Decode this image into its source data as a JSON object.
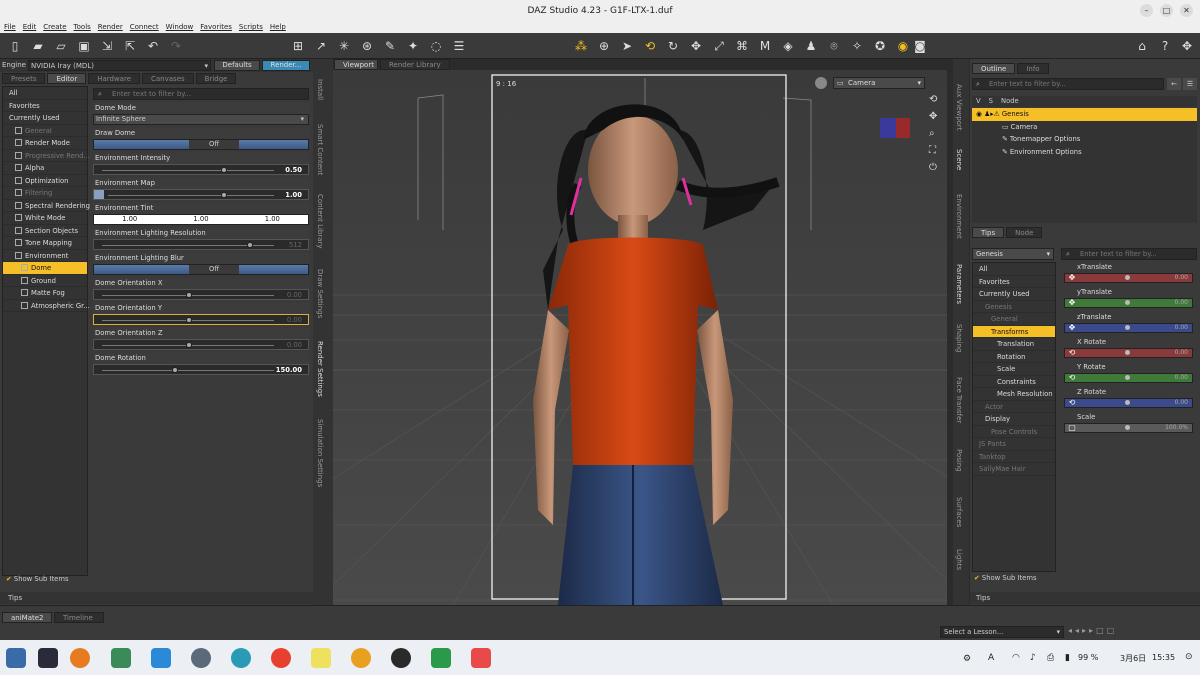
{
  "window": {
    "title": "DAZ Studio 4.23 - G1F-LTX-1.duf"
  },
  "menu": [
    "File",
    "Edit",
    "Create",
    "Tools",
    "Render",
    "Connect",
    "Window",
    "Favorites",
    "Scripts",
    "Help"
  ],
  "left_panel": {
    "engine_label": "Engine :",
    "engine_value": "NVIDIA Iray (MDL)",
    "defaults_btn": "Defaults",
    "render_btn": "Render...",
    "tabs": [
      "Presets",
      "Editor",
      "Hardware",
      "Canvases",
      "Bridge"
    ],
    "active_tab": "Editor",
    "filter_placeholder": "Enter text to filter by...",
    "categories": [
      {
        "label": "All",
        "state": "normal",
        "indent": 0
      },
      {
        "label": "Favorites",
        "state": "normal",
        "indent": 0
      },
      {
        "label": "Currently Used",
        "state": "normal",
        "indent": 0
      },
      {
        "label": "General",
        "state": "dim",
        "indent": 1
      },
      {
        "label": "Render Mode",
        "state": "normal",
        "indent": 1
      },
      {
        "label": "Progressive Rend...",
        "state": "dim",
        "indent": 1
      },
      {
        "label": "Alpha",
        "state": "normal",
        "indent": 1
      },
      {
        "label": "Optimization",
        "state": "normal",
        "indent": 1
      },
      {
        "label": "Filtering",
        "state": "dim",
        "indent": 1
      },
      {
        "label": "Spectral Rendering",
        "state": "normal",
        "indent": 1
      },
      {
        "label": "White Mode",
        "state": "normal",
        "indent": 1
      },
      {
        "label": "Section Objects",
        "state": "normal",
        "indent": 1
      },
      {
        "label": "Tone Mapping",
        "state": "normal",
        "indent": 1
      },
      {
        "label": "Environment",
        "state": "normal",
        "indent": 1
      },
      {
        "label": "Dome",
        "state": "selected",
        "indent": 2
      },
      {
        "label": "Ground",
        "state": "normal",
        "indent": 2
      },
      {
        "label": "Matte Fog",
        "state": "normal",
        "indent": 2
      },
      {
        "label": "Atmospheric Gr...",
        "state": "normal",
        "indent": 2
      }
    ],
    "show_sub_items": "Show Sub Items",
    "properties": {
      "dome_mode": {
        "label": "Dome Mode",
        "value": "Infinite Sphere"
      },
      "draw_dome": {
        "label": "Draw Dome",
        "value": "Off"
      },
      "env_intensity": {
        "label": "Environment Intensity",
        "value": "0.50",
        "level": 0.7
      },
      "env_map": {
        "label": "Environment Map",
        "value": "1.00",
        "level": 0.7
      },
      "env_tint": {
        "label": "Environment Tint",
        "r": "1.00",
        "g": "1.00",
        "b": "1.00"
      },
      "env_light_res": {
        "label": "Environment Lighting Resolution",
        "value": "512",
        "level": 0.85
      },
      "env_light_blur": {
        "label": "Environment Lighting Blur",
        "value": "Off"
      },
      "dome_orient_x": {
        "label": "Dome Orientation X",
        "value": "0.00",
        "level": 0.5
      },
      "dome_orient_y": {
        "label": "Dome Orientation Y",
        "value": "0.00",
        "level": 0.5
      },
      "dome_orient_z": {
        "label": "Dome Orientation Z",
        "value": "0.00",
        "level": 0.5
      },
      "dome_rotation": {
        "label": "Dome Rotation",
        "value": "150.00",
        "level": 0.42
      }
    },
    "tips": "Tips"
  },
  "side_tabs_left": [
    "Install",
    "Smart Content",
    "Content Library",
    "Draw Settings",
    "Render Settings",
    "Simulation Settings"
  ],
  "viewport": {
    "tabs": [
      "Viewport",
      "Render Library"
    ],
    "camera": "Camera",
    "aspect": "9 : 16"
  },
  "right_panel": {
    "outline_tabs": [
      "Outline",
      "Info"
    ],
    "filter_placeholder": "Enter text to filter by...",
    "col_headers": [
      "V",
      "S",
      "Node"
    ],
    "nodes": [
      {
        "label": "Genesis",
        "selected": true
      },
      {
        "label": "Camera",
        "selected": false
      },
      {
        "label": "Tonemapper Options",
        "selected": false
      },
      {
        "label": "Environment Options",
        "selected": false
      }
    ],
    "tips_tabs": [
      "Tips",
      "Node"
    ],
    "figure_select": "Genesis",
    "param_cats": [
      {
        "label": "All",
        "state": "normal"
      },
      {
        "label": "Favorites",
        "state": "normal"
      },
      {
        "label": "Currently Used",
        "state": "normal"
      },
      {
        "label": "Genesis",
        "state": "dim"
      },
      {
        "label": "General",
        "state": "dim"
      },
      {
        "label": "Transforms",
        "state": "selected"
      },
      {
        "label": "Translation",
        "state": "normal"
      },
      {
        "label": "Rotation",
        "state": "normal"
      },
      {
        "label": "Scale",
        "state": "normal"
      },
      {
        "label": "Constraints",
        "state": "normal"
      },
      {
        "label": "Mesh Resolution",
        "state": "normal"
      },
      {
        "label": "Actor",
        "state": "dim"
      },
      {
        "label": "Display",
        "state": "normal"
      },
      {
        "label": "Pose Controls",
        "state": "dim"
      },
      {
        "label": "JS Pants",
        "state": "dim"
      },
      {
        "label": "Tanktop",
        "state": "dim"
      },
      {
        "label": "SallyMae Hair",
        "state": "dim"
      }
    ],
    "params": [
      {
        "label": "xTranslate",
        "value": "0.00",
        "color": "#8a3a3a"
      },
      {
        "label": "yTranslate",
        "value": "0.00",
        "color": "#3f7a3a"
      },
      {
        "label": "zTranslate",
        "value": "0.00",
        "color": "#3a4a8a"
      },
      {
        "label": "X Rotate",
        "value": "0.00",
        "color": "#8a3a3a"
      },
      {
        "label": "Y Rotate",
        "value": "0.00",
        "color": "#3f7a3a"
      },
      {
        "label": "Z Rotate",
        "value": "0.00",
        "color": "#3a4a8a"
      },
      {
        "label": "Scale",
        "value": "100.0%",
        "color": "#5a5a5a"
      }
    ],
    "show_sub_items": "Show Sub Items",
    "tips": "Tips"
  },
  "side_tabs_right": [
    "Aux Viewport",
    "Scene",
    "Environment",
    "Parameters",
    "Shaping",
    "Face Transfer",
    "Posing",
    "Surfaces",
    "Lights"
  ],
  "bottom": {
    "tabs": [
      "aniMate2",
      "Timeline"
    ],
    "lesson_select": "Select a Lesson..."
  },
  "taskbar": {
    "battery": "99 %",
    "ime": "A",
    "date": "3月6日",
    "time": "15:35"
  }
}
